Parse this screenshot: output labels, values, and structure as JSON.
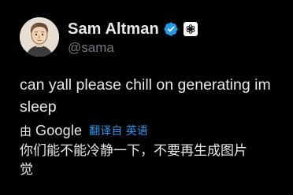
{
  "author": {
    "name": "Sam Altman",
    "handle": "@sama",
    "verified_color": "#1d9bf0",
    "avatar": "cartoon-portrait",
    "org_badge": "openai-logo-icon"
  },
  "tweet": {
    "lines": [
      "can yall please chill on generating im",
      "sleep"
    ]
  },
  "translation_bar": {
    "by": "由",
    "provider": "Google",
    "action": "翻译自 英语"
  },
  "translation": {
    "lines": [
      "你们能不能冷静一下，不要再生成图片",
      "觉"
    ]
  },
  "colors": {
    "background": "#000000",
    "text": "#e7e9ea",
    "secondary": "#71767b",
    "accent": "#1d9bf0"
  }
}
